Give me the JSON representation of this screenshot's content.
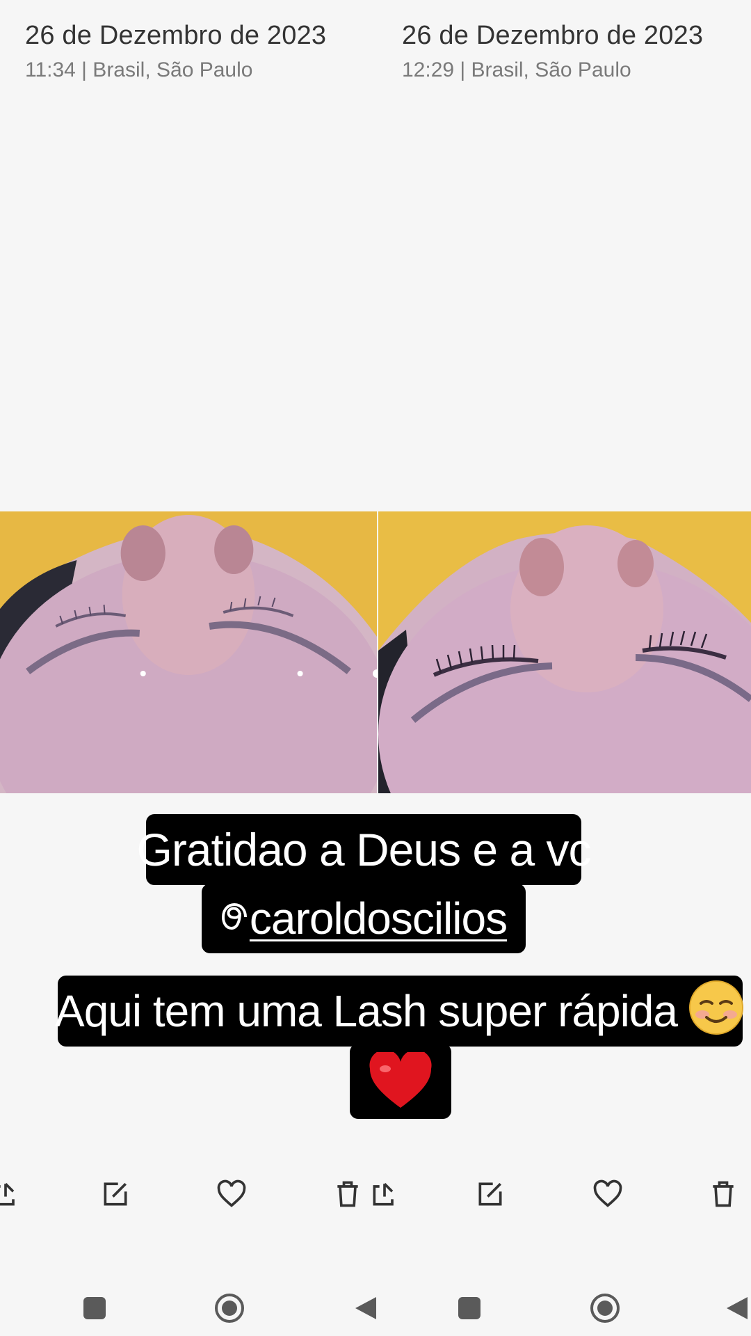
{
  "left_panel": {
    "date": "26 de Dezembro de 2023",
    "meta": "11:34 | Brasil, São Paulo"
  },
  "right_panel": {
    "date": "26 de Dezembro de 2023",
    "meta": "12:29 | Brasil, São Paulo"
  },
  "stickers": {
    "line1": "Gratidao a Deus e a vc",
    "line2_handle": "caroldoscilios",
    "line3": "Aqui tem uma Lash super rápida",
    "heart_emoji": "❤"
  },
  "toolbar_icons": [
    "share-icon",
    "edit-icon",
    "heart-icon",
    "trash-icon"
  ],
  "navbar_icons": [
    "recents-square-icon",
    "home-circle-icon",
    "back-triangle-icon"
  ],
  "colors": {
    "background": "#f6f6f6",
    "sticker_bg": "#000000",
    "sticker_text": "#ffffff",
    "icon": "#333333"
  }
}
